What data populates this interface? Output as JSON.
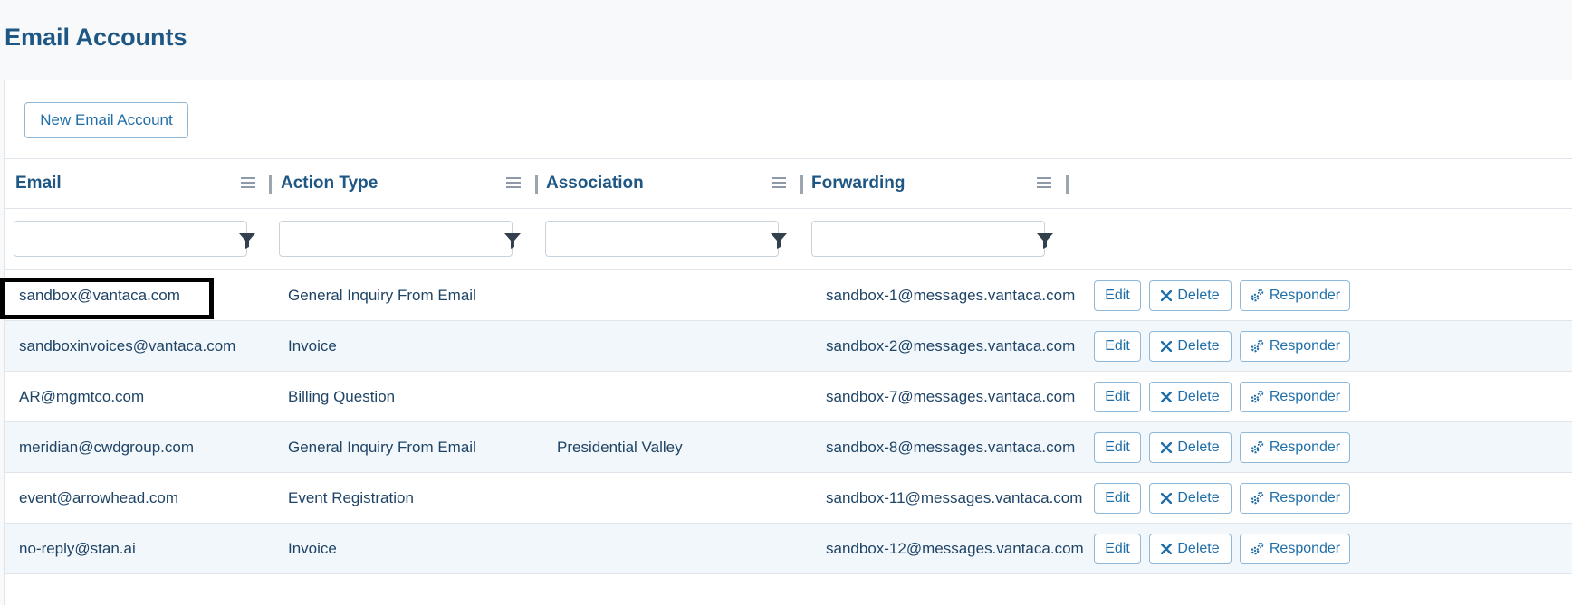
{
  "page": {
    "title": "Email Accounts"
  },
  "toolbar": {
    "new_label": "New Email Account"
  },
  "columns": [
    {
      "key": "email",
      "label": "Email"
    },
    {
      "key": "action_type",
      "label": "Action Type"
    },
    {
      "key": "association",
      "label": "Association"
    },
    {
      "key": "forwarding",
      "label": "Forwarding"
    }
  ],
  "filters": {
    "email": "",
    "action_type": "",
    "association": "",
    "forwarding": ""
  },
  "actions": {
    "edit": "Edit",
    "delete": "Delete",
    "responder": "Responder"
  },
  "rows": [
    {
      "email": "sandbox@vantaca.com",
      "action_type": "General Inquiry From Email",
      "association": "",
      "forwarding": "sandbox-1@messages.vantaca.com"
    },
    {
      "email": "sandboxinvoices@vantaca.com",
      "action_type": "Invoice",
      "association": "",
      "forwarding": "sandbox-2@messages.vantaca.com"
    },
    {
      "email": "AR@mgmtco.com",
      "action_type": "Billing Question",
      "association": "",
      "forwarding": "sandbox-7@messages.vantaca.com"
    },
    {
      "email": "meridian@cwdgroup.com",
      "action_type": "General Inquiry From Email",
      "association": "Presidential Valley",
      "forwarding": "sandbox-8@messages.vantaca.com"
    },
    {
      "email": "event@arrowhead.com",
      "action_type": "Event Registration",
      "association": "",
      "forwarding": "sandbox-11@messages.vantaca.com"
    },
    {
      "email": "no-reply@stan.ai",
      "action_type": "Invoice",
      "association": "",
      "forwarding": "sandbox-12@messages.vantaca.com"
    }
  ],
  "colors": {
    "accent": "#1f6ea8",
    "title": "#1f5784",
    "alt_row": "#f2f7fb"
  }
}
